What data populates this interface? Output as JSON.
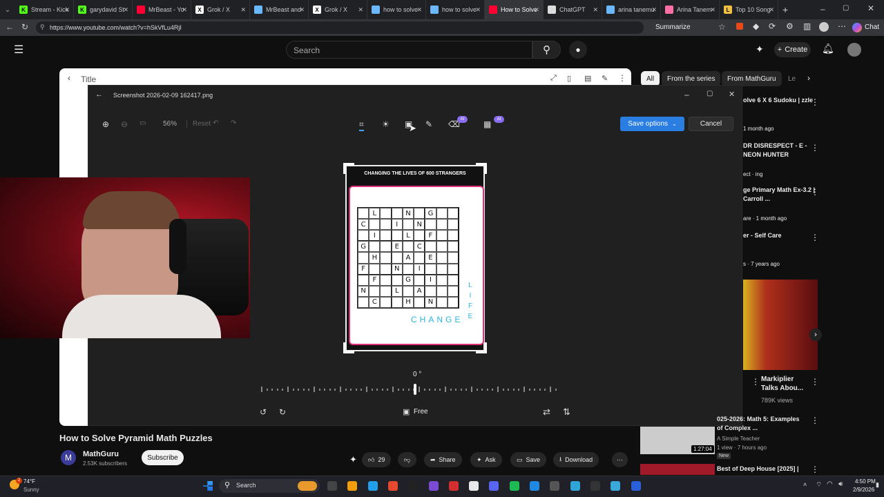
{
  "browser": {
    "tabs": [
      {
        "label": "Stream - Kick",
        "fav": "K",
        "color": "#53fc18"
      },
      {
        "label": "garydavid St",
        "fav": "K",
        "color": "#53fc18"
      },
      {
        "label": "MrBeast - Yo",
        "fav": "",
        "color": "#ff0033"
      },
      {
        "label": "Grok / X",
        "fav": "X",
        "color": "#ffffff"
      },
      {
        "label": "MrBeast and",
        "fav": "",
        "color": "#6bb8ff"
      },
      {
        "label": "Grok / X",
        "fav": "X",
        "color": "#ffffff"
      },
      {
        "label": "how to solve",
        "fav": "",
        "color": "#6bb8ff"
      },
      {
        "label": "how to solve",
        "fav": "",
        "color": "#6bb8ff"
      },
      {
        "label": "How to Solve",
        "fav": "",
        "color": "#ff0033",
        "active": true
      },
      {
        "label": "ChatGPT",
        "fav": "",
        "color": "#dddddd"
      },
      {
        "label": "arina tanemu",
        "fav": "",
        "color": "#6bb8ff"
      },
      {
        "label": "Arina Tanem",
        "fav": "",
        "color": "#ff6fa5"
      },
      {
        "label": "Top 10 Song",
        "fav": "L",
        "color": "#f0c040"
      }
    ],
    "url": "https://www.youtube.com/watch?v=hSkVfLu4RjI",
    "summarize": "Summarize",
    "chat": "Chat"
  },
  "youtube": {
    "search_placeholder": "Search",
    "create": "Create",
    "panel_title": "Title",
    "chips": [
      "All",
      "From the series",
      "From MathGuru",
      "Le"
    ],
    "video_title": "How to Solve Pyramid Math Puzzles",
    "channel": "MathGuru",
    "avatar_letter": "M",
    "subscribers": "2.53K subscribers",
    "subscribe": "Subscribe",
    "likes": "29",
    "share": "Share",
    "ask": "Ask",
    "save": "Save",
    "download": "Download",
    "suggestions": [
      {
        "title": "olve 6 X 6 Sudoku | zzle",
        "meta": "1 month ago"
      },
      {
        "title": "DR DISRESPECT - E - NEON HUNTER",
        "meta": "ect · ing"
      },
      {
        "title": "ge Primary Math Ex-3.2 | Carroll ...",
        "meta": "are · 1 month ago"
      },
      {
        "title": "er - Self Care",
        "meta": "s · 7 years ago"
      }
    ],
    "markiplier": {
      "title": "Markiplier Talks Abou...",
      "views": "789K views"
    },
    "thumb2": {
      "title": "025-2026: Math 5: Examples of Complex ...",
      "channel": "A Simple Teacher",
      "meta": "1 view · 7 hours ago",
      "badge": "New",
      "duration": "1:27:04"
    },
    "thumb3": {
      "title": "Best of Deep House [2025] |"
    }
  },
  "editor": {
    "filename": "Screenshot 2026-02-09 162417.png",
    "zoom": "56%",
    "reset": "Reset",
    "save_options": "Save options",
    "cancel": "Cancel",
    "ai_badge": "AI",
    "angle": "0 °",
    "aspect": "Free"
  },
  "puzzle": {
    "header": "CHANGING THE LIVES OF 600 STRANGERS",
    "grid": [
      [
        "",
        "L",
        "",
        "",
        "N",
        "",
        "G",
        "",
        ""
      ],
      [
        "C",
        "",
        "",
        "I",
        "",
        "N",
        "",
        "",
        ""
      ],
      [
        "",
        "I",
        "",
        "",
        "L",
        "",
        "F",
        "",
        ""
      ],
      [
        "G",
        "",
        "",
        "E",
        "",
        "C",
        "",
        "",
        ""
      ],
      [
        "",
        "H",
        "",
        "",
        "A",
        "",
        "E",
        "",
        ""
      ],
      [
        "F",
        "",
        "",
        "N",
        "",
        "I",
        "",
        "",
        ""
      ],
      [
        "",
        "F",
        "",
        "",
        "G",
        "",
        "I",
        "",
        ""
      ],
      [
        "N",
        "",
        "",
        "L",
        "",
        "A",
        "",
        "",
        ""
      ],
      [
        "",
        "C",
        "",
        "",
        "H",
        "",
        "N",
        "",
        ""
      ]
    ],
    "side_word": "LIFE",
    "bottom_word": "CHANGE"
  },
  "taskbar": {
    "weather_temp": "74°F",
    "weather_desc": "Sunny",
    "search": "Search",
    "time": "4:50 PM",
    "date": "2/9/2026",
    "notif": "2"
  }
}
